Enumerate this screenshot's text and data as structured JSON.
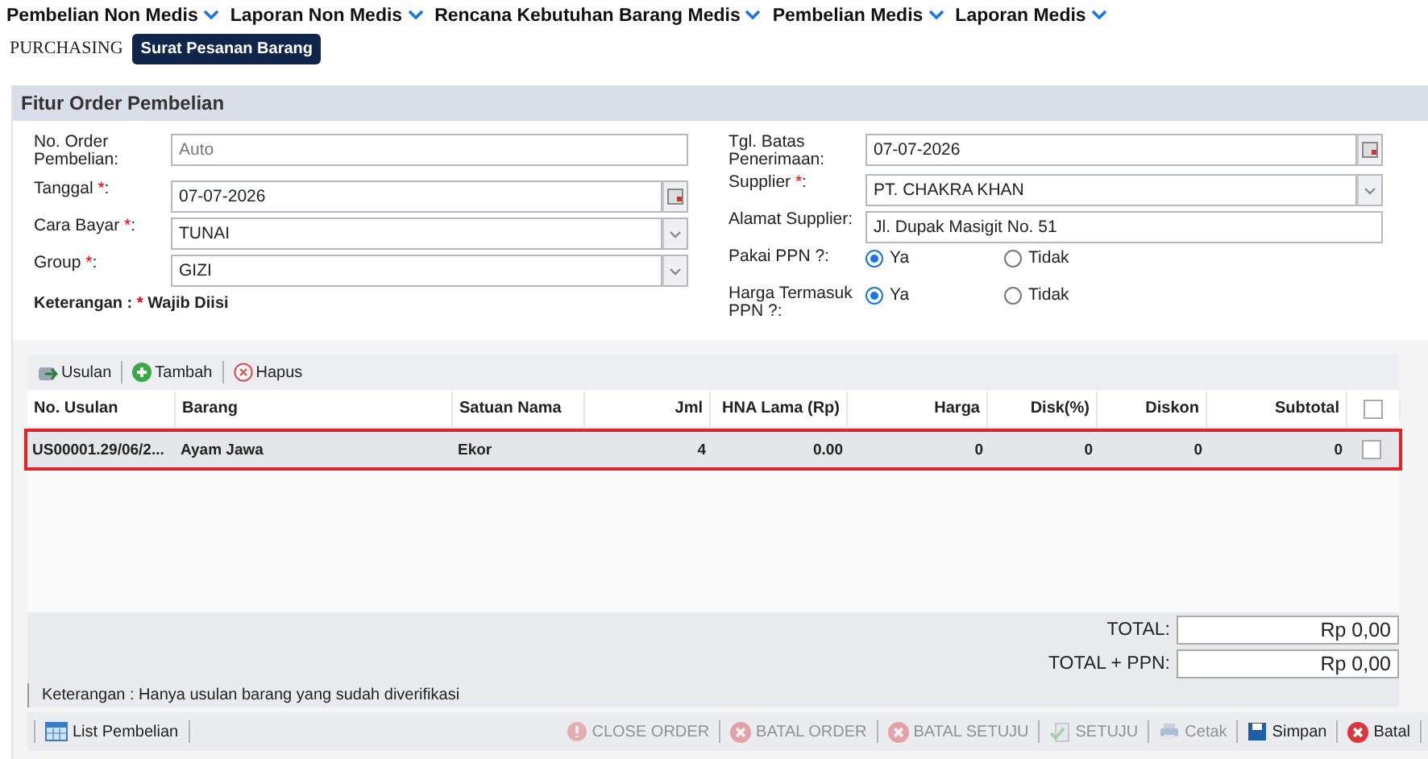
{
  "menu": [
    {
      "label": "Pembelian Non Medis"
    },
    {
      "label": "Laporan Non Medis"
    },
    {
      "label": "Rencana Kebutuhan Barang Medis"
    },
    {
      "label": "Pembelian Medis"
    },
    {
      "label": "Laporan Medis"
    }
  ],
  "breadcrumb": {
    "section": "PURCHASING",
    "page": "Surat Pesanan Barang"
  },
  "panel": {
    "title": "Fitur Order Pembelian"
  },
  "form_left": [
    {
      "kind": "text",
      "label": "No. Order Pembelian:",
      "placeholder": "Auto"
    },
    {
      "kind": "date",
      "label": "Tanggal",
      "mark": "*",
      "suffix": ":",
      "value": "07-07-2026"
    },
    {
      "kind": "select",
      "label": "Cara Bayar",
      "mark": "*",
      "suffix": ":",
      "value": "TUNAI"
    },
    {
      "kind": "select",
      "label": "Group",
      "mark": "*",
      "suffix": ":",
      "value": "GIZI"
    }
  ],
  "note": {
    "label": "Keterangan :",
    "mark": "*",
    "text": "Wajib Diisi"
  },
  "form_right": [
    {
      "kind": "date",
      "label": "Tgl. Batas Penerimaan:",
      "value": "07-07-2026"
    },
    {
      "kind": "select",
      "label": "Supplier",
      "mark": "*",
      "suffix": ":",
      "value": "PT. CHAKRA KHAN"
    },
    {
      "kind": "text",
      "label": "Alamat Supplier:",
      "value": "Jl. Dupak Masigit No. 51"
    },
    {
      "kind": "radio",
      "label": "Pakai PPN ?:",
      "options": [
        {
          "label": "Ya",
          "selected": true
        },
        {
          "label": "Tidak",
          "selected": false
        }
      ]
    },
    {
      "kind": "radio",
      "label": "Harga Termasuk PPN ?:",
      "options": [
        {
          "label": "Ya",
          "selected": true
        },
        {
          "label": "Tidak",
          "selected": false
        }
      ]
    }
  ],
  "grid_toolbar": [
    {
      "kind": "usulan",
      "label": "Usulan"
    },
    {
      "kind": "add",
      "label": "Tambah"
    },
    {
      "kind": "delete",
      "label": "Hapus"
    }
  ],
  "table": {
    "columns": [
      "No. Usulan",
      "Barang",
      "Satuan Nama",
      "Jml",
      "HNA Lama (Rp)",
      "Harga",
      "Disk(%)",
      "Diskon",
      "Subtotal"
    ],
    "header_checked": false,
    "rows": [
      {
        "cells": [
          "US00001.29/06/2...",
          "Ayam Jawa",
          "Ekor",
          "4",
          "0.00",
          "0",
          "0",
          "0",
          "0"
        ],
        "selected": true,
        "checked": false
      }
    ]
  },
  "totals": [
    {
      "label": "TOTAL:",
      "value": "Rp 0,00"
    },
    {
      "label": "TOTAL + PPN:",
      "value": "Rp 0,00"
    }
  ],
  "footer_note": "Keterangan : Hanya usulan barang yang sudah diverifikasi",
  "bottom_left": {
    "label": "List Pembelian"
  },
  "actions": [
    {
      "kind": "close",
      "label": "CLOSE ORDER",
      "disabled": true
    },
    {
      "kind": "cancel",
      "label": "BATAL ORDER",
      "disabled": true
    },
    {
      "kind": "cancel",
      "label": "BATAL SETUJU",
      "disabled": true
    },
    {
      "kind": "approve",
      "label": "SETUJU",
      "disabled": true
    },
    {
      "kind": "print",
      "label": "Cetak",
      "disabled": true
    },
    {
      "kind": "save",
      "label": "Simpan",
      "disabled": false
    },
    {
      "kind": "cancel",
      "label": "Batal",
      "disabled": false
    }
  ]
}
